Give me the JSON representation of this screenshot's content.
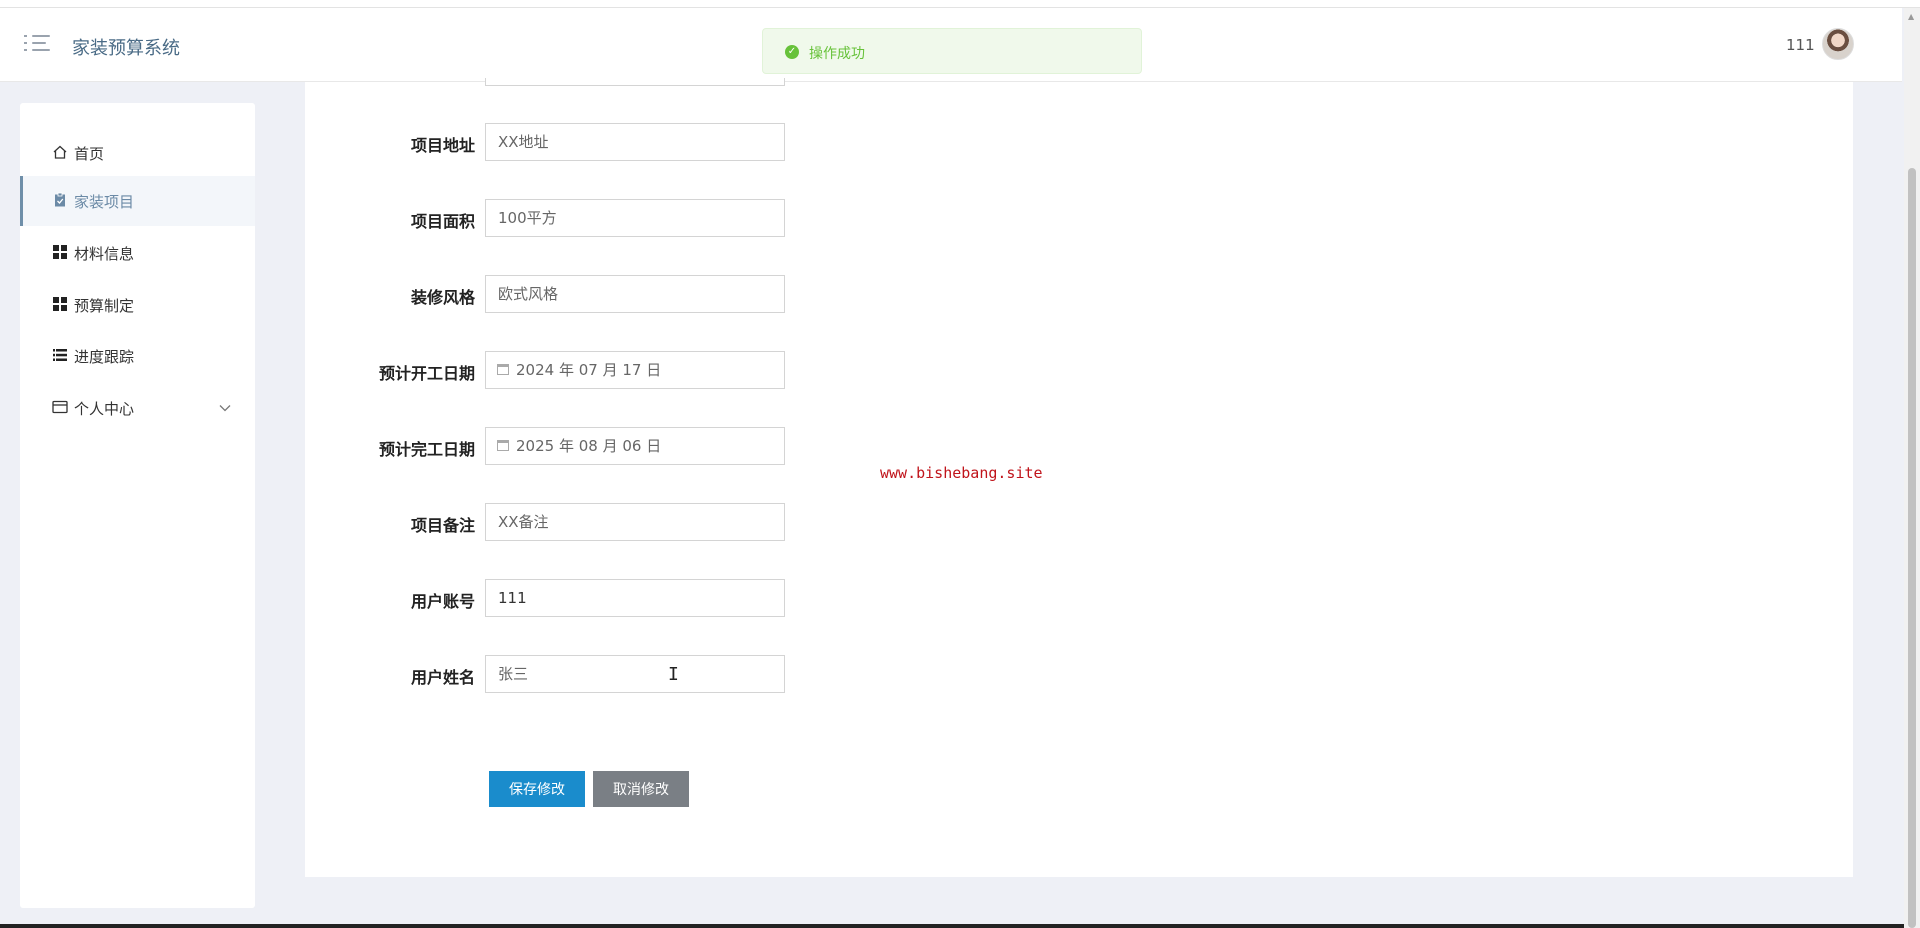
{
  "header": {
    "brand": "家装预算系统",
    "toast_message": "操作成功",
    "user_name": "111"
  },
  "sidebar": {
    "items": [
      {
        "label": "首页",
        "icon": "home-icon"
      },
      {
        "label": "家装项目",
        "icon": "clipboard-icon",
        "active": true
      },
      {
        "label": "材料信息",
        "icon": "grid-icon"
      },
      {
        "label": "预算制定",
        "icon": "grid-icon"
      },
      {
        "label": "进度跟踪",
        "icon": "list-icon"
      },
      {
        "label": "个人中心",
        "icon": "wallet-icon",
        "has_submenu": true
      }
    ]
  },
  "form": {
    "fields": [
      {
        "label": "项目地址",
        "value": "XX地址"
      },
      {
        "label": "项目面积",
        "value": "100平方"
      },
      {
        "label": "装修风格",
        "value": "欧式风格"
      },
      {
        "label": "预计开工日期",
        "value": "2024 年 07 月 17 日",
        "type": "date"
      },
      {
        "label": "预计完工日期",
        "value": "2025 年 08 月 06 日",
        "type": "date"
      },
      {
        "label": "项目备注",
        "value": "XX备注"
      },
      {
        "label": "用户账号",
        "value": "111"
      },
      {
        "label": "用户姓名",
        "value": "张三"
      }
    ],
    "save_label": "保存修改",
    "cancel_label": "取消修改"
  },
  "watermark": "www.bishebang.site",
  "colors": {
    "accent": "#1a8ccc",
    "sidebar_active": "#6b8aa6",
    "success": "#67c23a"
  }
}
